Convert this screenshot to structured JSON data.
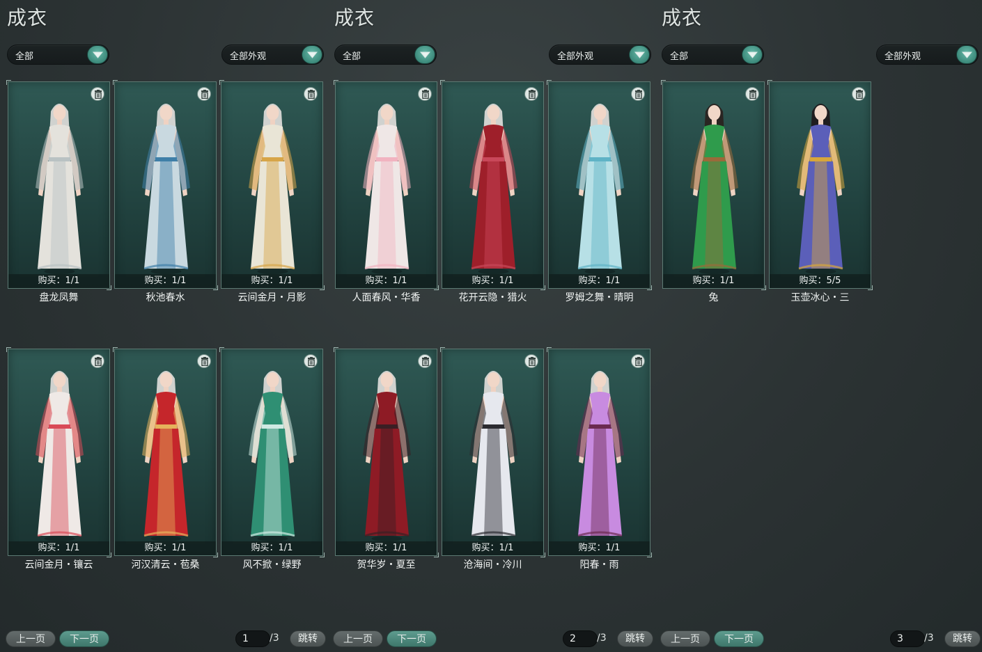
{
  "panels": [
    {
      "title": "成衣",
      "filter_left": "全部",
      "filter_right": "全部外观",
      "items": [
        {
          "name": "盘龙凤舞",
          "buy": "购买：1/1",
          "outfit": "#e4e2dc",
          "accent": "#b9c2c3",
          "hair": "#d9d9d6"
        },
        {
          "name": "秋池春水",
          "buy": "购买：1/1",
          "outfit": "#c9d9e0",
          "accent": "#3f7fa8",
          "hair": "#d9d9d6"
        },
        {
          "name": "云间金月・月影",
          "buy": "购买：1/1",
          "outfit": "#e9e5d6",
          "accent": "#d7a548",
          "hair": "#d9d9d6"
        },
        {
          "name": "云间金月・镶云",
          "buy": "购买：1/1",
          "outfit": "#efe9e6",
          "accent": "#d94a57",
          "hair": "#d9d9d6"
        },
        {
          "name": "河汉清云・苞桑",
          "buy": "购买：1/1",
          "outfit": "#c5262b",
          "accent": "#e5b25c",
          "hair": "#d9d9d6"
        },
        {
          "name": "风不掀・绿野",
          "buy": "购买：1/1",
          "outfit": "#2f8f73",
          "accent": "#cfe9e2",
          "hair": "#d9d9d6"
        }
      ],
      "prev_label": "上一页",
      "next_label": "下一页",
      "page": "1",
      "total": "/3",
      "jump_label": "跳转"
    },
    {
      "title": "成衣",
      "filter_left": "全部",
      "filter_right": "全部外观",
      "items": [
        {
          "name": "人面春风・华香",
          "buy": "购买：1/1",
          "outfit": "#efe7e6",
          "accent": "#f1b3c0",
          "hair": "#d9d9d6"
        },
        {
          "name": "花开云隐・猎火",
          "buy": "购买：1/1",
          "outfit": "#9e1f2a",
          "accent": "#c9485a",
          "hair": "#d9d9d6"
        },
        {
          "name": "罗姆之舞・晴明",
          "buy": "购买：1/1",
          "outfit": "#b7e0e6",
          "accent": "#5fb3c6",
          "hair": "#d9d9d6"
        },
        {
          "name": "贺华岁・夏至",
          "buy": "购买：1/1",
          "outfit": "#8e1b25",
          "accent": "#3a1f24",
          "hair": "#d9d9d6"
        },
        {
          "name": "沧海间・冷川",
          "buy": "购买：1/1",
          "outfit": "#e6e8ee",
          "accent": "#2b2b30",
          "hair": "#d9d9d6"
        },
        {
          "name": "阳春・雨",
          "buy": "购买：1/1",
          "outfit": "#c88be0",
          "accent": "#6b2a50",
          "hair": "#d9d9d6"
        }
      ],
      "prev_label": "上一页",
      "next_label": "下一页",
      "page": "2",
      "total": "/3",
      "jump_label": "跳转"
    },
    {
      "title": "成衣",
      "filter_left": "全部",
      "filter_right": "全部外观",
      "items": [
        {
          "name": "兔",
          "buy": "购买：1/1",
          "outfit": "#2f9b4c",
          "accent": "#9a6a3a",
          "hair": "#2a2320"
        },
        {
          "name": "玉壶冰心・三",
          "buy": "购买：5/5",
          "outfit": "#5b5fb9",
          "accent": "#d7a63b",
          "hair": "#1f1a1c"
        }
      ],
      "prev_label": "上一页",
      "next_label": "下一页",
      "page": "3",
      "total": "/3",
      "jump_label": "跳转"
    }
  ]
}
